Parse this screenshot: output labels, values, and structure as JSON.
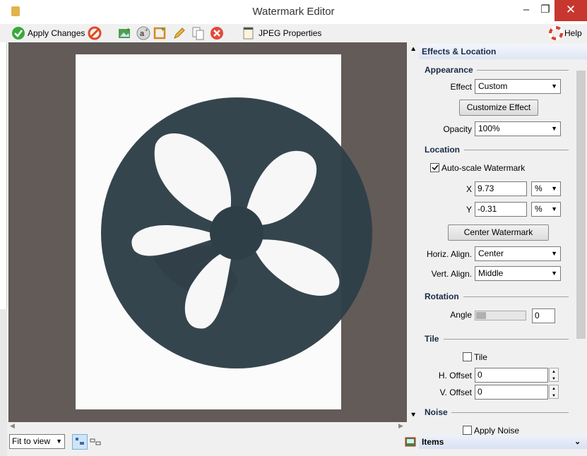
{
  "window": {
    "title": "Watermark Editor",
    "minimize": "–",
    "maximize": "❐",
    "close": "✕"
  },
  "toolbar": {
    "apply_label": "Apply Changes",
    "jpeg_label": "JPEG Properties",
    "help_label": "Help"
  },
  "canvas": {
    "zoom": "Fit to view"
  },
  "panel": {
    "title": "Effects & Location",
    "appearance": {
      "heading": "Appearance",
      "effect_label": "Effect",
      "effect_value": "Custom",
      "customize_button": "Customize Effect",
      "opacity_label": "Opacity",
      "opacity_value": "100%"
    },
    "location": {
      "heading": "Location",
      "autoscale_label": "Auto-scale Watermark",
      "autoscale_checked": true,
      "x_label": "X",
      "x_value": "9.73",
      "x_unit": "%",
      "y_label": "Y",
      "y_value": "-0.31",
      "y_unit": "%",
      "center_button": "Center Watermark",
      "halign_label": "Horiz. Align.",
      "halign_value": "Center",
      "valign_label": "Vert. Align.",
      "valign_value": "Middle"
    },
    "rotation": {
      "heading": "Rotation",
      "angle_label": "Angle",
      "angle_value": "0"
    },
    "tile": {
      "heading": "Tile",
      "tile_label": "Tile",
      "tile_checked": false,
      "hoffset_label": "H. Offset",
      "hoffset_value": "0",
      "voffset_label": "V. Offset",
      "voffset_value": "0"
    },
    "noise": {
      "heading": "Noise",
      "apply_label": "Apply Noise",
      "apply_checked": false
    },
    "items_label": "Items"
  },
  "colors": {
    "watermark": "#2e3f47",
    "canvas_bg": "#625b57",
    "close_red": "#c7362f"
  }
}
